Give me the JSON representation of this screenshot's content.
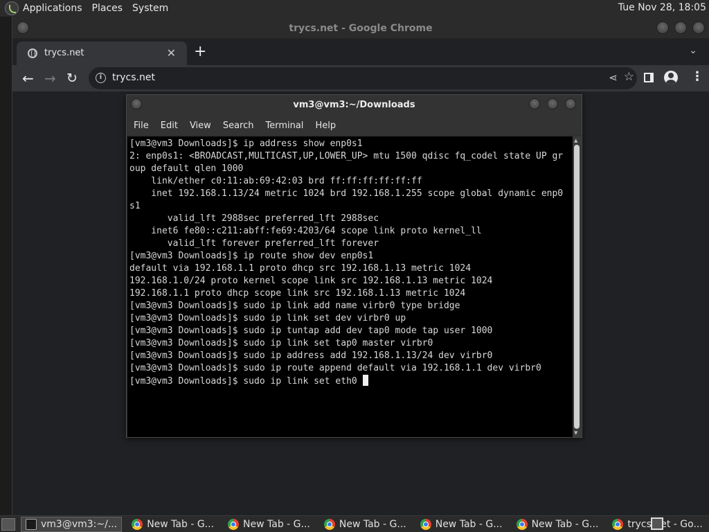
{
  "top_panel": {
    "menus": [
      "Applications",
      "Places",
      "System"
    ],
    "clock": "Tue Nov 28, 18:05"
  },
  "chrome": {
    "window_title": "trycs.net - Google Chrome",
    "tab_title": "trycs.net",
    "url": "trycs.net"
  },
  "terminal": {
    "window_title": "vm3@vm3:~/Downloads",
    "menu": [
      "File",
      "Edit",
      "View",
      "Search",
      "Terminal",
      "Help"
    ],
    "lines": [
      "[vm3@vm3 Downloads]$ ip address show enp0s1",
      "2: enp0s1: <BROADCAST,MULTICAST,UP,LOWER_UP> mtu 1500 qdisc fq_codel state UP gr",
      "oup default qlen 1000",
      "    link/ether c0:11:ab:69:42:03 brd ff:ff:ff:ff:ff:ff",
      "    inet 192.168.1.13/24 metric 1024 brd 192.168.1.255 scope global dynamic enp0",
      "s1",
      "       valid_lft 2988sec preferred_lft 2988sec",
      "    inet6 fe80::c211:abff:fe69:4203/64 scope link proto kernel_ll",
      "       valid_lft forever preferred_lft forever",
      "[vm3@vm3 Downloads]$ ip route show dev enp0s1",
      "default via 192.168.1.1 proto dhcp src 192.168.1.13 metric 1024",
      "192.168.1.0/24 proto kernel scope link src 192.168.1.13 metric 1024",
      "192.168.1.1 proto dhcp scope link src 192.168.1.13 metric 1024",
      "[vm3@vm3 Downloads]$ sudo ip link add name virbr0 type bridge",
      "[vm3@vm3 Downloads]$ sudo ip link set dev virbr0 up",
      "[vm3@vm3 Downloads]$ sudo ip tuntap add dev tap0 mode tap user 1000",
      "[vm3@vm3 Downloads]$ sudo ip link set tap0 master virbr0",
      "[vm3@vm3 Downloads]$ sudo ip address add 192.168.1.13/24 dev virbr0",
      "[vm3@vm3 Downloads]$ sudo ip route append default via 192.168.1.1 dev virbr0"
    ],
    "current_prompt": "[vm3@vm3 Downloads]$ sudo ip link set eth0 "
  },
  "taskbar": {
    "tasks": [
      {
        "label": "vm3@vm3:~/...",
        "icon": "terminal-icon",
        "active": true
      },
      {
        "label": "New Tab - G...",
        "icon": "chrome-icon",
        "active": false
      },
      {
        "label": "New Tab - G...",
        "icon": "chrome-icon",
        "active": false
      },
      {
        "label": "New Tab - G...",
        "icon": "chrome-icon",
        "active": false
      },
      {
        "label": "New Tab - G...",
        "icon": "chrome-icon",
        "active": false
      },
      {
        "label": "New Tab - G...",
        "icon": "chrome-icon",
        "active": false
      },
      {
        "label": "trycs.net - Go...",
        "icon": "chrome-icon",
        "active": false
      }
    ]
  }
}
